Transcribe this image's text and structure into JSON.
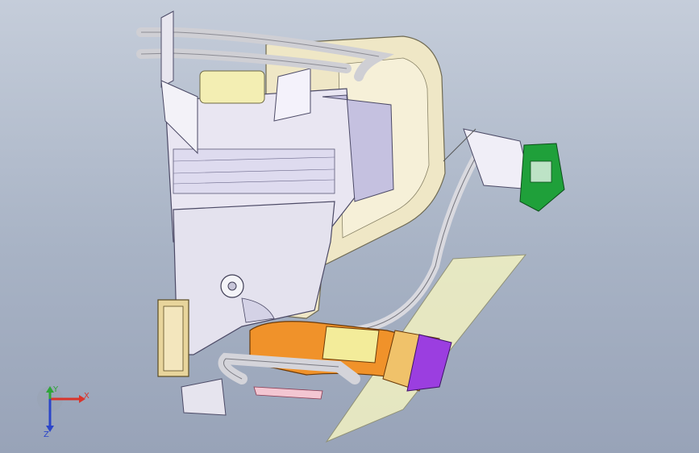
{
  "viewport": {
    "background_top": "#c5cdda",
    "background_bottom": "#98a3b8"
  },
  "triad": {
    "x_label": "X",
    "y_label": "Y",
    "z_label": "Z",
    "x_color": "#d9342b",
    "y_color": "#2fa53a",
    "z_color": "#2b45c9"
  },
  "model_colors": {
    "housing": "#e9e6f2",
    "housing_shadow": "#b8b4d8",
    "duct": "#efe7c6",
    "pipe": "#d6d6da",
    "orange_duct": "#f0922a",
    "yellow_panel": "#f3ec9a",
    "green_module": "#1fa03a",
    "purple_part": "#9b3ee0",
    "tan_filter": "#e8d59c",
    "sheet": "#eeeec2"
  }
}
